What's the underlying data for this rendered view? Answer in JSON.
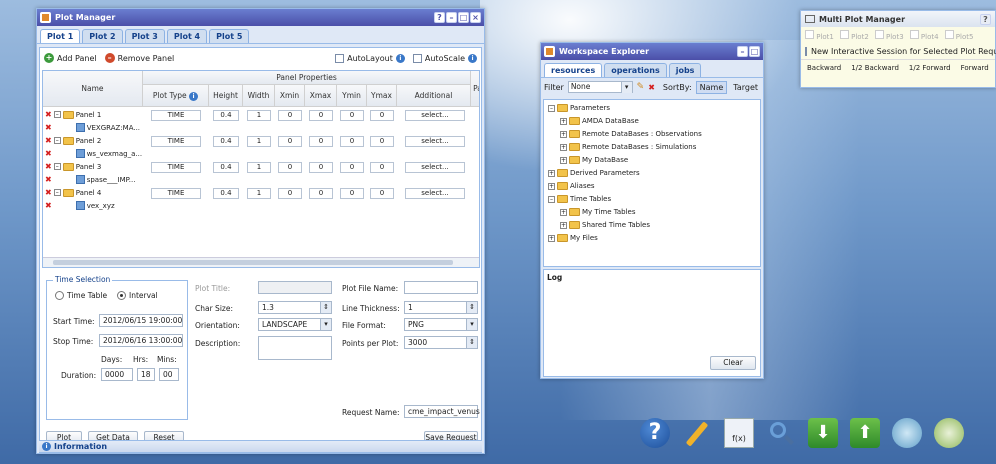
{
  "plot_manager": {
    "title": "Plot Manager",
    "tabs": [
      "Plot 1",
      "Plot 2",
      "Plot 3",
      "Plot 4",
      "Plot 5"
    ],
    "add_panel": "Add Panel",
    "remove_panel": "Remove Panel",
    "autolayout": "AutoLayout",
    "autoscale": "AutoScale",
    "col_name": "Name",
    "col_panel_props": "Panel Properties",
    "col_plot_type": "Plot Type",
    "col_height": "Height",
    "col_width": "Width",
    "col_xmin": "Xmin",
    "col_xmax": "Xmax",
    "col_ymin": "Ymin",
    "col_ymax": "Ymax",
    "col_additional": "Additional",
    "col_pa": "Pa",
    "rows": [
      {
        "name": "Panel 1",
        "type": "TIME",
        "height": "0.4",
        "width": "1",
        "xmin": "0",
        "xmax": "0",
        "ymin": "0",
        "ymax": "0",
        "add": "select..."
      },
      {
        "name": "VEXGRAZ:MA..."
      },
      {
        "name": "Panel 2",
        "type": "TIME",
        "height": "0.4",
        "width": "1",
        "xmin": "0",
        "xmax": "0",
        "ymin": "0",
        "ymax": "0",
        "add": "select..."
      },
      {
        "name": "ws_vexmag_a..."
      },
      {
        "name": "Panel 3",
        "type": "TIME",
        "height": "0.4",
        "width": "1",
        "xmin": "0",
        "xmax": "0",
        "ymin": "0",
        "ymax": "0",
        "add": "select..."
      },
      {
        "name": "spase___IMP..."
      },
      {
        "name": "Panel 4",
        "type": "TIME",
        "height": "0.4",
        "width": "1",
        "xmin": "0",
        "xmax": "0",
        "ymin": "0",
        "ymax": "0",
        "add": "select..."
      },
      {
        "name": "vex_xyz"
      }
    ],
    "time_selection": "Time Selection",
    "time_table": "Time Table",
    "interval": "Interval",
    "start_time_label": "Start Time:",
    "start_time": "2012/06/15 19:00:00",
    "stop_time_label": "Stop Time:",
    "stop_time": "2012/06/16 13:00:00",
    "days": "Days:",
    "hrs": "Hrs:",
    "mins": "Mins:",
    "duration_label": "Duration:",
    "dur_days": "0000",
    "dur_hrs": "18",
    "dur_mins": "00",
    "plot_title_label": "Plot Title:",
    "char_size_label": "Char Size:",
    "char_size": "1.3",
    "orientation_label": "Orientation:",
    "orientation": "LANDSCAPE",
    "description_label": "Description:",
    "file_name_label": "Plot File Name:",
    "line_thickness_label": "Line Thickness:",
    "line_thickness": "1",
    "file_format_label": "File Format:",
    "file_format": "PNG",
    "points_label": "Points per Plot:",
    "points": "3000",
    "request_name_label": "Request Name:",
    "request_name": "cme_impact_venus",
    "btn_plot": "Plot",
    "btn_get_data": "Get Data",
    "btn_reset": "Reset",
    "btn_save": "Save Request",
    "information": "Information"
  },
  "workspace": {
    "title": "Workspace Explorer",
    "tabs": [
      "resources",
      "operations",
      "jobs"
    ],
    "filter_label": "Filter",
    "filter_value": "None",
    "sortby": "SortBy:",
    "sort_name": "Name",
    "sort_target": "Target",
    "tree": [
      "Parameters",
      "AMDA DataBase",
      "Remote DataBases : Observations",
      "Remote DataBases : Simulations",
      "My DataBase",
      "Derived Parameters",
      "Aliases",
      "Time Tables",
      "My Time Tables",
      "Shared Time Tables",
      "My Files"
    ],
    "log": "Log",
    "clear": "Clear"
  },
  "multi": {
    "title": "Multi Plot Manager",
    "plots": [
      "Plot1",
      "Plot2",
      "Plot3",
      "Plot4",
      "Plot5"
    ],
    "new_session": "New Interactive Session for Selected Plot Requests",
    "backward": "Backward",
    "half_back": "1/2 Backward",
    "half_fwd": "1/2 Forward",
    "forward": "Forward"
  }
}
